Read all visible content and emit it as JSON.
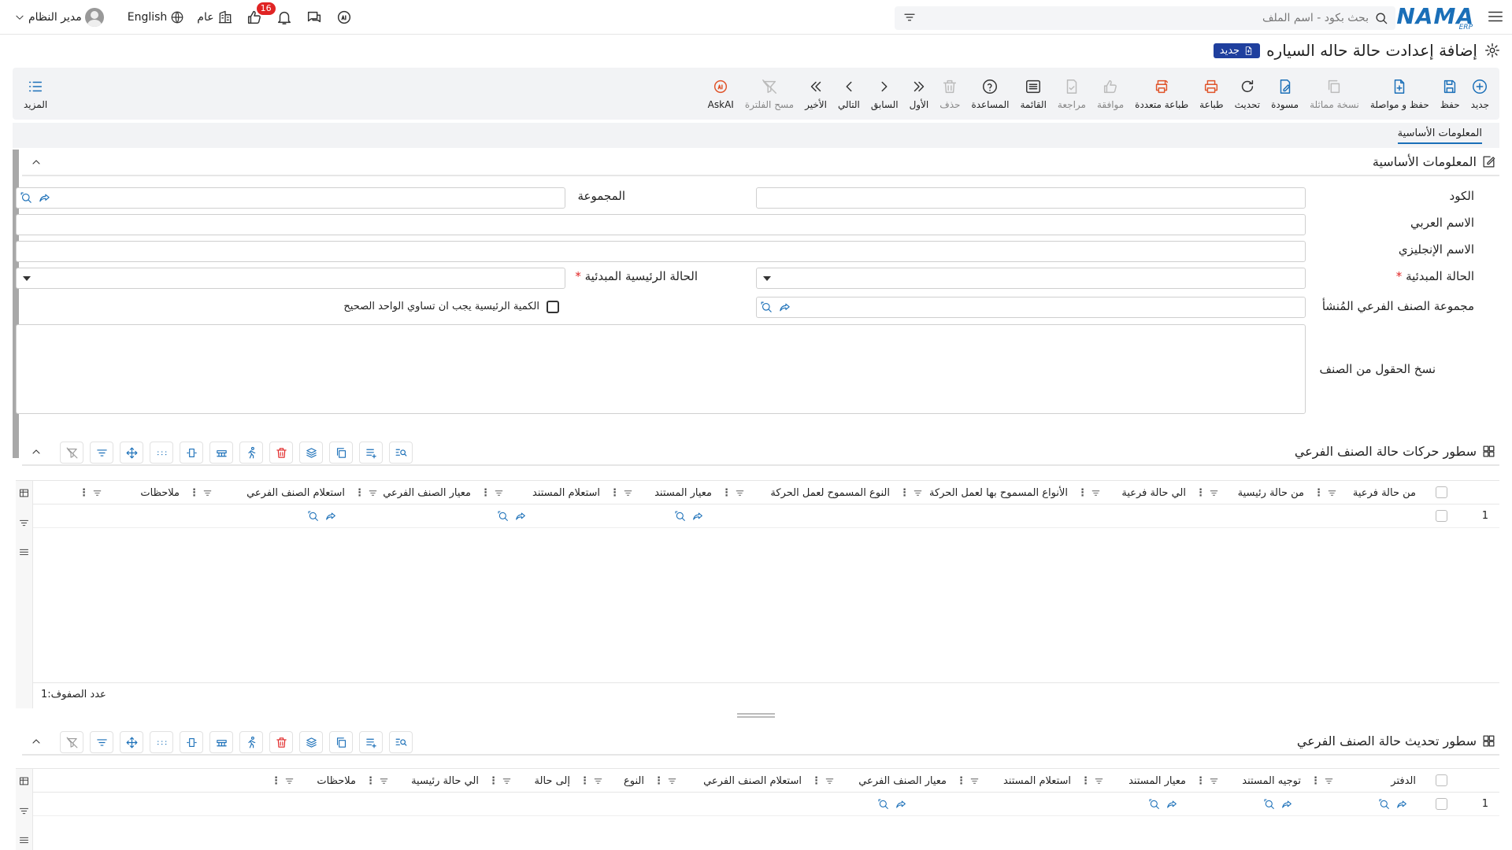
{
  "topbar": {
    "search_placeholder": "بحث بكود - اسم الملف",
    "language": "English",
    "branch": "عام",
    "notification_count": "16",
    "user": "مدير النظام",
    "logo_text": "NAMA",
    "logo_sub": "ERP"
  },
  "page": {
    "title": "إضافة إعدادت حالة حاله السياره",
    "badge": "جديد"
  },
  "toolbar": {
    "items": [
      {
        "label": "جديد",
        "icon": "plus-circle-icon"
      },
      {
        "label": "حفظ",
        "icon": "save-icon"
      },
      {
        "label": "حفظ و مواصلة",
        "icon": "save-continue-icon"
      },
      {
        "label": "نسخة مماثلة",
        "icon": "copy-icon"
      },
      {
        "label": "مسودة",
        "icon": "draft-icon"
      },
      {
        "label": "تحديث",
        "icon": "refresh-icon"
      },
      {
        "label": "طباعة",
        "icon": "print-icon"
      },
      {
        "label": "طباعة متعددة",
        "icon": "multi-print-icon"
      },
      {
        "label": "موافقة",
        "icon": "approve-icon"
      },
      {
        "label": "مراجعة",
        "icon": "review-icon"
      },
      {
        "label": "القائمة",
        "icon": "list-icon"
      },
      {
        "label": "المساعدة",
        "icon": "help-icon"
      },
      {
        "label": "حذف",
        "icon": "trash-icon"
      },
      {
        "label": "الأول",
        "icon": "first-icon"
      },
      {
        "label": "السابق",
        "icon": "previous-icon"
      },
      {
        "label": "التالي",
        "icon": "next-icon"
      },
      {
        "label": "الأخير",
        "icon": "last-icon"
      },
      {
        "label": "مسح الفلترة",
        "icon": "clear-filter-icon"
      },
      {
        "label": "AskAI",
        "icon": "ai-icon"
      }
    ],
    "more": "المزيد"
  },
  "tabs": {
    "basic": "المعلومات الأساسية"
  },
  "basic_section": {
    "title": "المعلومات الأساسية",
    "code": "الكود",
    "group": "المجموعة",
    "arabic_name": "الاسم العربي",
    "english_name": "الاسم الإنجليزي",
    "initial_status": "الحالة المبدئية",
    "initial_main_status": "الحالة الرئيسية المبدئية",
    "origin_group": "مجموعة الصنف الفرعي المُنشأ",
    "main_qty_rule": "الكمية الرئيسية يجب ان تساوي الواحد الصحيح",
    "copy_fields": "نسخ الحقول من الصنف",
    "required_mark": "*"
  },
  "grid1": {
    "title": "سطور حركات حالة الصنف الفرعي",
    "columns": [
      "من حالة فرعية",
      "من حالة رئيسية",
      "الي حالة فرعية",
      "الأنواع المسموح بها لعمل الحركة",
      "النوع المسموح لعمل الحركة",
      "معيار المستند",
      "استعلام المستند",
      "معيار الصنف الفرعي",
      "استعلام الصنف الفرعي",
      "ملاحظات"
    ],
    "row_num": "1",
    "rows_count_label": "عدد الصفوف:",
    "rows_count": "1"
  },
  "grid2": {
    "title": "سطور تحديث حالة الصنف الفرعي",
    "columns": [
      "الدفتر",
      "توجيه المستند",
      "معيار المستند",
      "استعلام المستند",
      "معيار الصنف الفرعي",
      "استعلام الصنف الفرعي",
      "النوع",
      "إلى حالة",
      "الي حالة رئيسية",
      "ملاحظات"
    ],
    "row_num": "1"
  },
  "colors": {
    "accent": "#1a6fb8",
    "danger": "#e02424",
    "badge_bg": "#1f3f9e",
    "print": "#e0542a"
  }
}
